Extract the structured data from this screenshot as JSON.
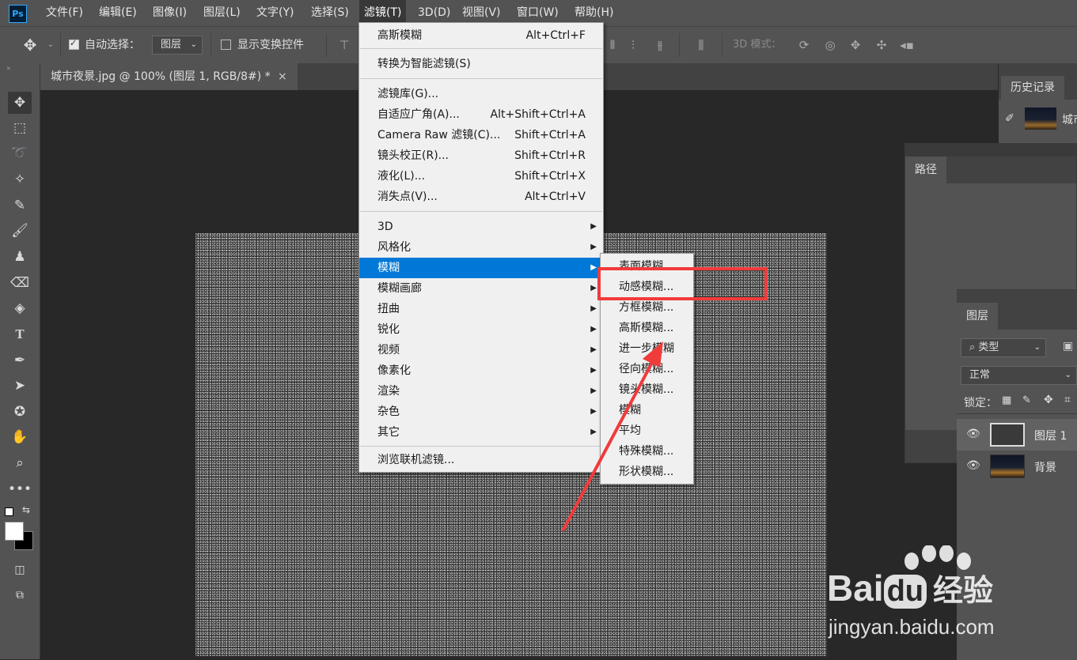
{
  "menubar": {
    "logo": "Ps",
    "items": [
      "文件(F)",
      "编辑(E)",
      "图像(I)",
      "图层(L)",
      "文字(Y)",
      "选择(S)",
      "滤镜(T)",
      "3D(D)",
      "视图(V)",
      "窗口(W)",
      "帮助(H)"
    ]
  },
  "options": {
    "auto_select_label": "自动选择：",
    "layer_select": "图层",
    "show_transform_label": "显示变换控件",
    "mode_3d_label": "3D 模式："
  },
  "document": {
    "tab_title": "城市夜景.jpg @ 100% (图层 1, RGB/8#) *",
    "close": "×"
  },
  "panels": {
    "history_tab": "历史记录",
    "history_item": "城市",
    "paths_tab": "路径",
    "layers_tab": "图层",
    "kind_filter": "类型",
    "blend_mode": "正常",
    "lock_label": "锁定：",
    "layers": [
      {
        "name": "图层 1",
        "selected": true
      },
      {
        "name": "背景",
        "selected": false
      }
    ]
  },
  "filter_menu": {
    "items": [
      {
        "label": "高斯模糊",
        "shortcut": "Alt+Ctrl+F"
      },
      {
        "label": "转换为智能滤镜(S)",
        "shortcut": ""
      },
      {
        "label": "滤镜库(G)...",
        "shortcut": ""
      },
      {
        "label": "自适应广角(A)...",
        "shortcut": "Alt+Shift+Ctrl+A"
      },
      {
        "label": "Camera Raw 滤镜(C)...",
        "shortcut": "Shift+Ctrl+A"
      },
      {
        "label": "镜头校正(R)...",
        "shortcut": "Shift+Ctrl+R"
      },
      {
        "label": "液化(L)...",
        "shortcut": "Shift+Ctrl+X"
      },
      {
        "label": "消失点(V)...",
        "shortcut": "Alt+Ctrl+V"
      },
      {
        "label": "3D",
        "shortcut": ""
      },
      {
        "label": "风格化",
        "shortcut": ""
      },
      {
        "label": "模糊",
        "shortcut": ""
      },
      {
        "label": "模糊画廊",
        "shortcut": ""
      },
      {
        "label": "扭曲",
        "shortcut": ""
      },
      {
        "label": "锐化",
        "shortcut": ""
      },
      {
        "label": "视频",
        "shortcut": ""
      },
      {
        "label": "像素化",
        "shortcut": ""
      },
      {
        "label": "渲染",
        "shortcut": ""
      },
      {
        "label": "杂色",
        "shortcut": ""
      },
      {
        "label": "其它",
        "shortcut": ""
      },
      {
        "label": "浏览联机滤镜...",
        "shortcut": ""
      }
    ],
    "arrow": "▶"
  },
  "blur_submenu": {
    "items": [
      "表面模糊...",
      "动感模糊...",
      "方框模糊...",
      "高斯模糊...",
      "进一步模糊",
      "径向模糊...",
      "镜头模糊...",
      "模糊",
      "平均",
      "特殊模糊...",
      "形状模糊..."
    ]
  },
  "watermark": {
    "brand_a": "Bai",
    "brand_b": "du",
    "brand_cn": "经验",
    "url": "jingyan.baidu.com"
  },
  "colors": {
    "highlight": "#0078d7",
    "annotation": "#f03b3b"
  }
}
